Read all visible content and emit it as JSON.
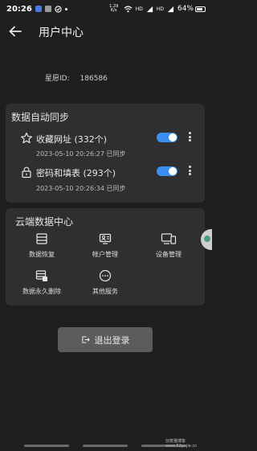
{
  "status_bar": {
    "time": "20:26",
    "network_top": "1.29",
    "network_bottom": "K/s",
    "signal1": "HD",
    "signal2": "HD",
    "battery": "64%"
  },
  "header": {
    "title": "用户中心",
    "back_icon": "arrow-left-icon"
  },
  "account": {
    "label": "星愿ID:",
    "id": "186586"
  },
  "sync": {
    "title": "数据自动同步",
    "items": [
      {
        "icon": "star-icon",
        "name": "收藏网址 (332个)",
        "time": "2023-05-10 20:26:27 已同步",
        "enabled": true
      },
      {
        "icon": "lock-icon",
        "name": "密码和填表 (293个)",
        "time": "2023-05-10 20:26:34 已同步",
        "enabled": true
      }
    ]
  },
  "cloud": {
    "title": "云端数据中心",
    "items": [
      {
        "icon": "data-recovery-icon",
        "label": "数据恢复"
      },
      {
        "icon": "account-manage-icon",
        "label": "帐户管理"
      },
      {
        "icon": "device-manage-icon",
        "label": "设备管理"
      },
      {
        "icon": "data-delete-icon",
        "label": "数据永久删除"
      },
      {
        "icon": "more-services-icon",
        "label": "其他服务"
      }
    ]
  },
  "logout": {
    "label": "退出登录",
    "icon": "logout-icon"
  },
  "watermark": {
    "line1": "创意猫博客",
    "line2": "www.52pojie.cn"
  },
  "colors": {
    "accent": "#3a8ff0",
    "background": "#1f1f1f",
    "card": "#2f2f2f",
    "button": "#5c5c5c"
  }
}
